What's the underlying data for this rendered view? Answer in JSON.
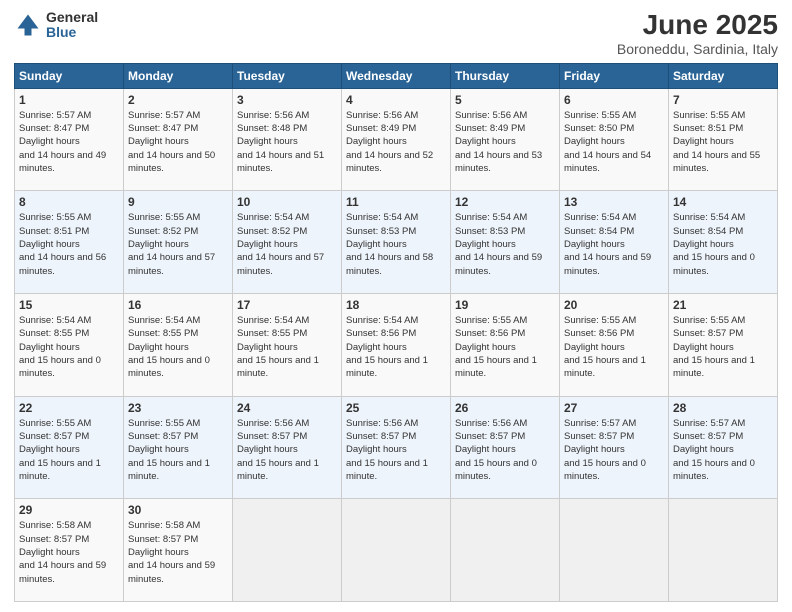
{
  "logo": {
    "general": "General",
    "blue": "Blue"
  },
  "title": "June 2025",
  "location": "Boroneddu, Sardinia, Italy",
  "headers": [
    "Sunday",
    "Monday",
    "Tuesday",
    "Wednesday",
    "Thursday",
    "Friday",
    "Saturday"
  ],
  "weeks": [
    [
      {
        "day": "1",
        "sunrise": "5:57 AM",
        "sunset": "8:47 PM",
        "daylight": "14 hours and 49 minutes."
      },
      {
        "day": "2",
        "sunrise": "5:57 AM",
        "sunset": "8:47 PM",
        "daylight": "14 hours and 50 minutes."
      },
      {
        "day": "3",
        "sunrise": "5:56 AM",
        "sunset": "8:48 PM",
        "daylight": "14 hours and 51 minutes."
      },
      {
        "day": "4",
        "sunrise": "5:56 AM",
        "sunset": "8:49 PM",
        "daylight": "14 hours and 52 minutes."
      },
      {
        "day": "5",
        "sunrise": "5:56 AM",
        "sunset": "8:49 PM",
        "daylight": "14 hours and 53 minutes."
      },
      {
        "day": "6",
        "sunrise": "5:55 AM",
        "sunset": "8:50 PM",
        "daylight": "14 hours and 54 minutes."
      },
      {
        "day": "7",
        "sunrise": "5:55 AM",
        "sunset": "8:51 PM",
        "daylight": "14 hours and 55 minutes."
      }
    ],
    [
      {
        "day": "8",
        "sunrise": "5:55 AM",
        "sunset": "8:51 PM",
        "daylight": "14 hours and 56 minutes."
      },
      {
        "day": "9",
        "sunrise": "5:55 AM",
        "sunset": "8:52 PM",
        "daylight": "14 hours and 57 minutes."
      },
      {
        "day": "10",
        "sunrise": "5:54 AM",
        "sunset": "8:52 PM",
        "daylight": "14 hours and 57 minutes."
      },
      {
        "day": "11",
        "sunrise": "5:54 AM",
        "sunset": "8:53 PM",
        "daylight": "14 hours and 58 minutes."
      },
      {
        "day": "12",
        "sunrise": "5:54 AM",
        "sunset": "8:53 PM",
        "daylight": "14 hours and 59 minutes."
      },
      {
        "day": "13",
        "sunrise": "5:54 AM",
        "sunset": "8:54 PM",
        "daylight": "14 hours and 59 minutes."
      },
      {
        "day": "14",
        "sunrise": "5:54 AM",
        "sunset": "8:54 PM",
        "daylight": "15 hours and 0 minutes."
      }
    ],
    [
      {
        "day": "15",
        "sunrise": "5:54 AM",
        "sunset": "8:55 PM",
        "daylight": "15 hours and 0 minutes."
      },
      {
        "day": "16",
        "sunrise": "5:54 AM",
        "sunset": "8:55 PM",
        "daylight": "15 hours and 0 minutes."
      },
      {
        "day": "17",
        "sunrise": "5:54 AM",
        "sunset": "8:55 PM",
        "daylight": "15 hours and 1 minute."
      },
      {
        "day": "18",
        "sunrise": "5:54 AM",
        "sunset": "8:56 PM",
        "daylight": "15 hours and 1 minute."
      },
      {
        "day": "19",
        "sunrise": "5:55 AM",
        "sunset": "8:56 PM",
        "daylight": "15 hours and 1 minute."
      },
      {
        "day": "20",
        "sunrise": "5:55 AM",
        "sunset": "8:56 PM",
        "daylight": "15 hours and 1 minute."
      },
      {
        "day": "21",
        "sunrise": "5:55 AM",
        "sunset": "8:57 PM",
        "daylight": "15 hours and 1 minute."
      }
    ],
    [
      {
        "day": "22",
        "sunrise": "5:55 AM",
        "sunset": "8:57 PM",
        "daylight": "15 hours and 1 minute."
      },
      {
        "day": "23",
        "sunrise": "5:55 AM",
        "sunset": "8:57 PM",
        "daylight": "15 hours and 1 minute."
      },
      {
        "day": "24",
        "sunrise": "5:56 AM",
        "sunset": "8:57 PM",
        "daylight": "15 hours and 1 minute."
      },
      {
        "day": "25",
        "sunrise": "5:56 AM",
        "sunset": "8:57 PM",
        "daylight": "15 hours and 1 minute."
      },
      {
        "day": "26",
        "sunrise": "5:56 AM",
        "sunset": "8:57 PM",
        "daylight": "15 hours and 0 minutes."
      },
      {
        "day": "27",
        "sunrise": "5:57 AM",
        "sunset": "8:57 PM",
        "daylight": "15 hours and 0 minutes."
      },
      {
        "day": "28",
        "sunrise": "5:57 AM",
        "sunset": "8:57 PM",
        "daylight": "15 hours and 0 minutes."
      }
    ],
    [
      {
        "day": "29",
        "sunrise": "5:58 AM",
        "sunset": "8:57 PM",
        "daylight": "14 hours and 59 minutes."
      },
      {
        "day": "30",
        "sunrise": "5:58 AM",
        "sunset": "8:57 PM",
        "daylight": "14 hours and 59 minutes."
      },
      null,
      null,
      null,
      null,
      null
    ]
  ]
}
